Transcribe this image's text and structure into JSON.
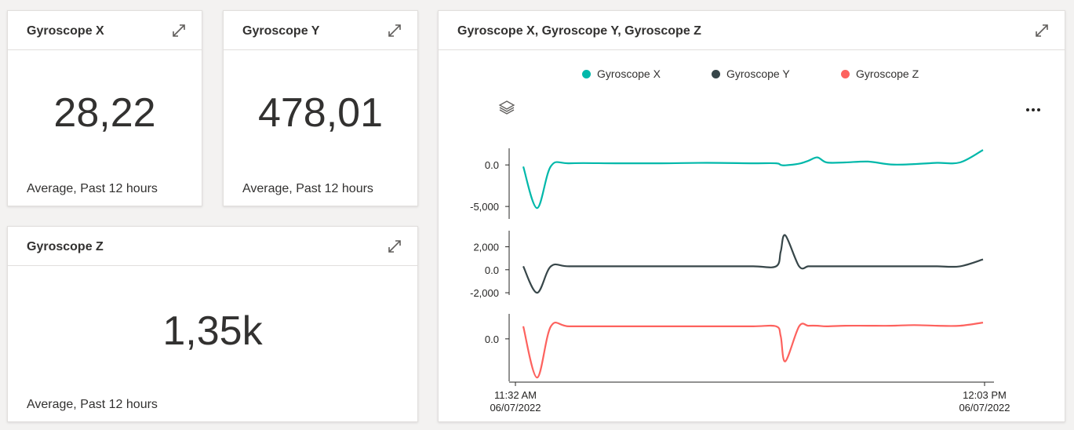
{
  "tiles": {
    "gyro_x": {
      "title": "Gyroscope X",
      "value": "28,22",
      "subtitle": "Average, Past 12 hours"
    },
    "gyro_y": {
      "title": "Gyroscope Y",
      "value": "478,01",
      "subtitle": "Average, Past 12 hours"
    },
    "gyro_z": {
      "title": "Gyroscope Z",
      "value": "1,35k",
      "subtitle": "Average, Past 12 hours"
    }
  },
  "chart_tile": {
    "title": "Gyroscope X, Gyroscope Y, Gyroscope Z"
  },
  "icons": {
    "expand": "expand-icon",
    "layers": "layers-icon",
    "more": "more-options-icon"
  },
  "chart_data": {
    "type": "line",
    "layout": "stacked-panels",
    "legend_position": "top",
    "grid": false,
    "x_labels": [
      {
        "time": "11:32 AM",
        "date": "06/07/2022"
      },
      {
        "time": "12:03 PM",
        "date": "06/07/2022"
      }
    ],
    "x": [
      0,
      0.03,
      0.06,
      0.1,
      0.2,
      0.3,
      0.4,
      0.5,
      0.55,
      0.56,
      0.57,
      0.6,
      0.62,
      0.64,
      0.66,
      0.7,
      0.75,
      0.8,
      0.85,
      0.9,
      0.95,
      1.0
    ],
    "series": [
      {
        "name": "Gyroscope X",
        "color": "#01b8aa",
        "yticks": [
          "0.0",
          "-5,000"
        ],
        "ytick_values": [
          0,
          -5000
        ],
        "ylim": [
          -6500,
          2000
        ],
        "values": [
          -200,
          -5200,
          -150,
          200,
          200,
          200,
          250,
          200,
          200,
          0,
          -50,
          150,
          500,
          900,
          300,
          300,
          400,
          50,
          100,
          250,
          300,
          1800
        ]
      },
      {
        "name": "Gyroscope Y",
        "color": "#374649",
        "yticks": [
          "2,000",
          "0.0",
          "-2,000"
        ],
        "ytick_values": [
          2000,
          0,
          -2000
        ],
        "ylim": [
          -2200,
          3400
        ],
        "values": [
          300,
          -2000,
          300,
          300,
          300,
          300,
          300,
          300,
          300,
          1600,
          3000,
          300,
          300,
          300,
          300,
          300,
          300,
          300,
          300,
          300,
          300,
          900
        ]
      },
      {
        "name": "Gyroscope Z",
        "color": "#fd625e",
        "yticks": [
          "0.0"
        ],
        "ytick_values": [
          0
        ],
        "ylim": [
          -3400,
          2000
        ],
        "values": [
          1000,
          -3100,
          1000,
          1000,
          1000,
          1000,
          1000,
          1000,
          1000,
          200,
          -1800,
          1000,
          1050,
          1050,
          1000,
          1050,
          1050,
          1050,
          1100,
          1050,
          1050,
          1300
        ]
      }
    ]
  }
}
